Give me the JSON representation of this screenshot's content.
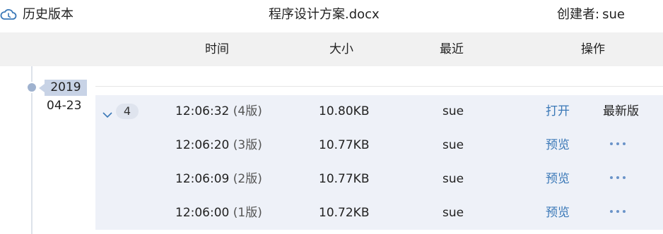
{
  "topbar": {
    "history_label": "历史版本",
    "doc_title": "程序设计方案.docx",
    "creator_label": "创建者:",
    "creator_name": "sue"
  },
  "columns": {
    "time": "时间",
    "size": "大小",
    "recent": "最近",
    "ops": "操作"
  },
  "timeline": {
    "year": "2019",
    "date": "04-23"
  },
  "group": {
    "count": "4",
    "versions": [
      {
        "time": "12:06:32",
        "version": "(4版)",
        "size": "10.80KB",
        "user": "sue",
        "action": "打开",
        "status": "最新版"
      },
      {
        "time": "12:06:20",
        "version": "(3版)",
        "size": "10.77KB",
        "user": "sue",
        "action": "预览"
      },
      {
        "time": "12:06:09",
        "version": "(2版)",
        "size": "10.77KB",
        "user": "sue",
        "action": "预览"
      },
      {
        "time": "12:06:00",
        "version": "(1版)",
        "size": "10.72KB",
        "user": "sue",
        "action": "预览"
      }
    ]
  },
  "icons": {
    "history": "cloud-history-icon",
    "collapse": "chevron-down-icon",
    "more": "more-icon"
  },
  "colors": {
    "accent": "#3a78b7",
    "header_bg": "#f1f1f1",
    "group_bg": "#eef1f8",
    "year_badge": "#c8d3e6"
  }
}
